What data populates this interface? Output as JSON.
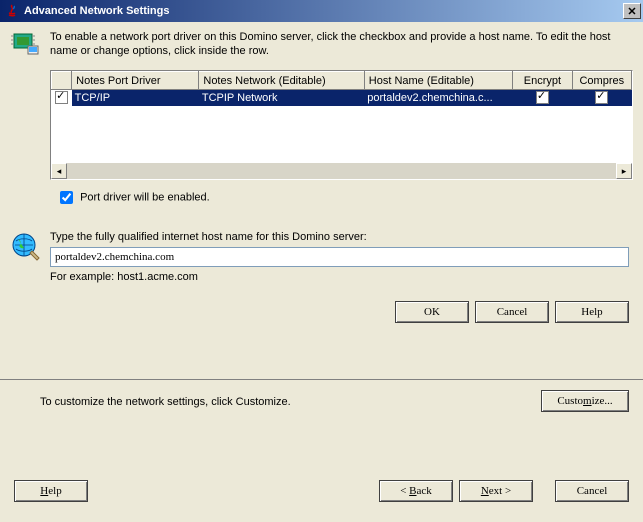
{
  "titlebar": {
    "title": "Advanced Network Settings"
  },
  "intro": "To enable a network port driver on this Domino server, click the checkbox and provide a host name. To edit the host name or change options, click inside the row.",
  "table": {
    "headers": {
      "driver": "Notes Port Driver",
      "network": "Notes Network (Editable)",
      "host": "Host Name (Editable)",
      "encrypt": "Encrypt",
      "compress": "Compres"
    },
    "row": {
      "enabled": true,
      "driver": "TCP/IP",
      "network": "TCPIP Network",
      "host": "portaldev2.chemchina.c...",
      "encrypt": true,
      "compress": true
    }
  },
  "port_enabled_label": "Port driver will be enabled.",
  "hostname_section": {
    "label": "Type the fully qualified internet host name for this Domino server:",
    "value": "portaldev2.chemchina.com",
    "example": "For example: host1.acme.com"
  },
  "dialog_buttons": {
    "ok": "OK",
    "cancel": "Cancel",
    "help": "Help"
  },
  "wizard": {
    "text": "To customize the network settings, click Customize.",
    "customize": "Customize...",
    "help": "Help",
    "back": "< Back",
    "next": "Next >",
    "cancel": "Cancel"
  }
}
